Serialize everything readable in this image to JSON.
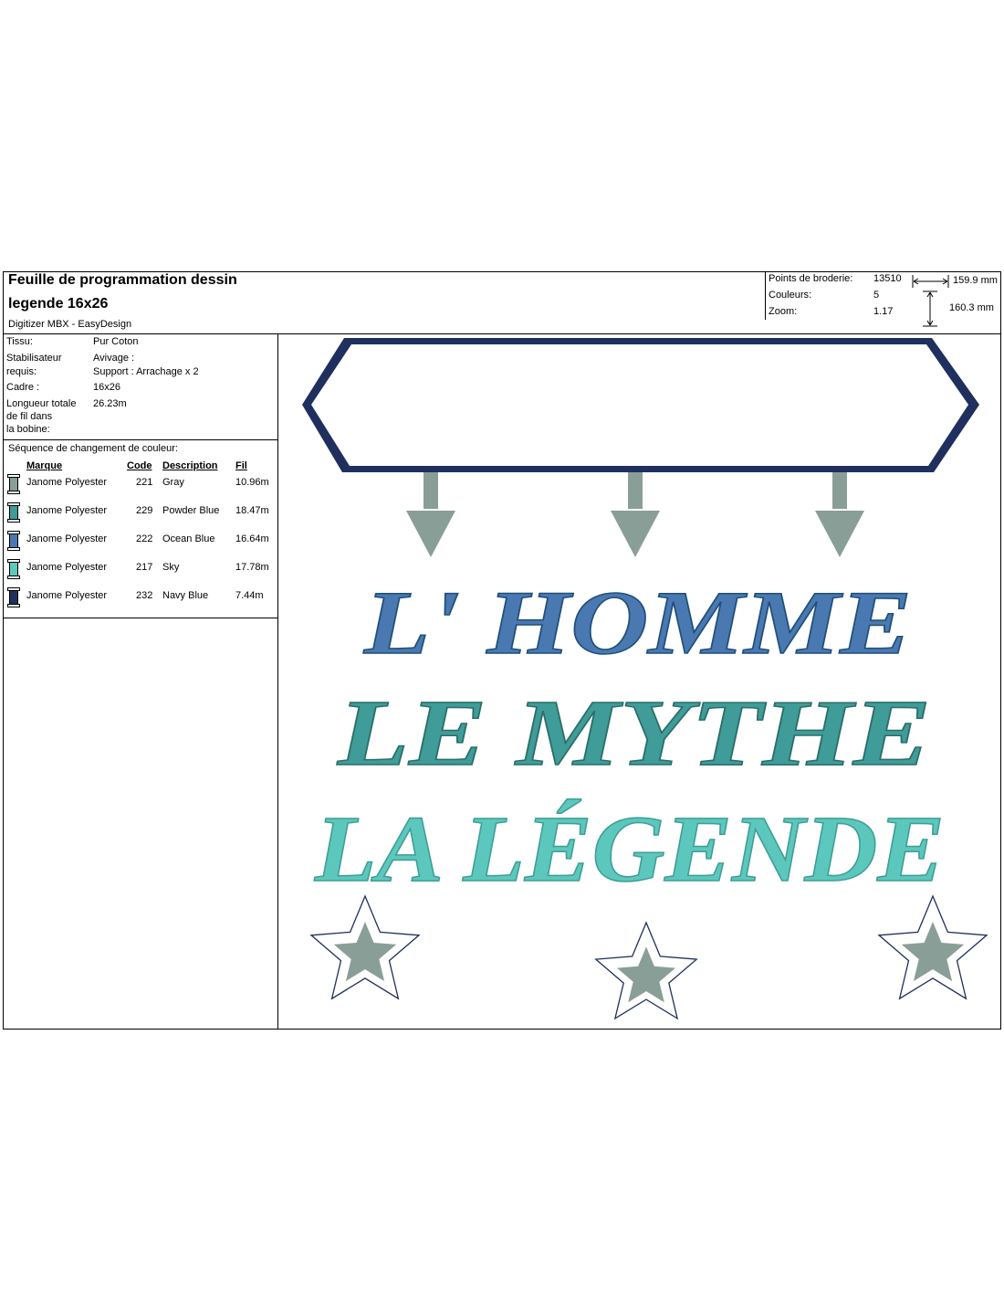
{
  "header": {
    "title": "Feuille de programmation dessin",
    "design_name": "legende 16x26",
    "software": "Digitizer MBX - EasyDesign"
  },
  "stats": {
    "stitches_label": "Points de broderie:",
    "stitches_value": "13510",
    "colors_label": "Couleurs:",
    "colors_value": "5",
    "zoom_label": "Zoom:",
    "zoom_value": "1.17",
    "width": "159.9 mm",
    "height": "160.3 mm"
  },
  "info": {
    "fabric_label": "Tissu:",
    "fabric_value": "Pur Coton",
    "stabilizer_label_1": "Stabilisateur",
    "stabilizer_label_2": "requis:",
    "stabilizer_value_1": "Avivage :",
    "stabilizer_value_2": "Support : Arrachage x 2",
    "frame_label": "Cadre :",
    "frame_value": "16x26",
    "thread_label_1": "Longueur totale",
    "thread_label_2": "de fil dans",
    "thread_label_3": "la bobine:",
    "thread_value": "26.23m"
  },
  "color_sequence": {
    "title": "Séquence de changement de couleur:",
    "headers": {
      "brand": "Marque",
      "code": "Code",
      "description": "Description",
      "thread": "Fil"
    },
    "rows": [
      {
        "brand": "Janome Polyester",
        "code": "221",
        "description": "Gray",
        "thread": "10.96m",
        "color": "#8a9e98"
      },
      {
        "brand": "Janome Polyester",
        "code": "229",
        "description": "Powder Blue",
        "thread": "18.47m",
        "color": "#3f9c98"
      },
      {
        "brand": "Janome Polyester",
        "code": "222",
        "description": "Ocean Blue",
        "thread": "16.64m",
        "color": "#4a78b0"
      },
      {
        "brand": "Janome Polyester",
        "code": "217",
        "description": "Sky",
        "thread": "17.78m",
        "color": "#5cc7bd"
      },
      {
        "brand": "Janome Polyester",
        "code": "232",
        "description": "Navy Blue",
        "thread": "7.44m",
        "color": "#1f2f5e"
      }
    ]
  },
  "design": {
    "line1": "L' HOMME",
    "line2": "LE MYTHE",
    "line3": "LA LÉGENDE"
  }
}
